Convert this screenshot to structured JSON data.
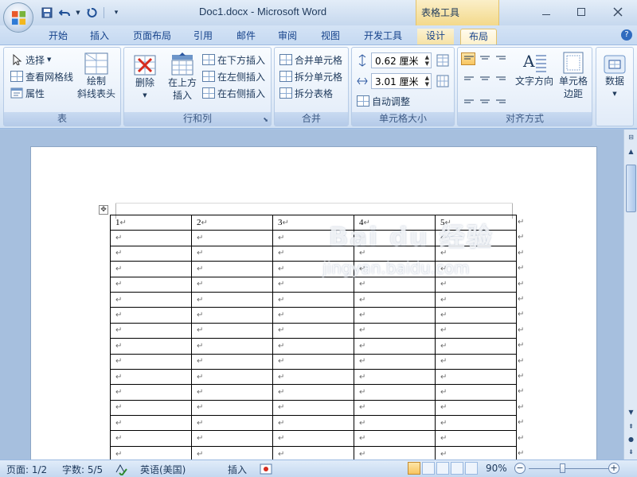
{
  "window": {
    "title": "Doc1.docx - Microsoft Word",
    "context_header": "表格工具"
  },
  "tabs": [
    {
      "label": "开始"
    },
    {
      "label": "插入"
    },
    {
      "label": "页面布局"
    },
    {
      "label": "引用"
    },
    {
      "label": "邮件"
    },
    {
      "label": "审阅"
    },
    {
      "label": "视图"
    },
    {
      "label": "开发工具"
    },
    {
      "label": "设计"
    },
    {
      "label": "布局"
    }
  ],
  "ribbon": {
    "table_group": {
      "label": "表",
      "select": "选择",
      "view_gridlines": "查看网格线",
      "properties": "属性",
      "draw_diagonal_line1": "绘制",
      "draw_diagonal_line2": "斜线表头"
    },
    "rows_cols_group": {
      "label": "行和列",
      "delete": "删除",
      "insert_above_line1": "在上方",
      "insert_above_line2": "插入",
      "insert_below": "在下方插入",
      "insert_left": "在左侧插入",
      "insert_right": "在右侧插入"
    },
    "merge_group": {
      "label": "合并",
      "merge_cells": "合并单元格",
      "split_cells": "拆分单元格",
      "split_table": "拆分表格"
    },
    "cell_size_group": {
      "label": "单元格大小",
      "height_value": "0.62 厘米",
      "width_value": "3.01 厘米",
      "autofit": "自动调整"
    },
    "alignment_group": {
      "label": "对齐方式",
      "text_direction": "文字方向",
      "cell_margins_line1": "单元格",
      "cell_margins_line2": "边距"
    },
    "data_group": {
      "label": "数据"
    }
  },
  "document": {
    "header_row": [
      "1",
      "2",
      "3",
      "4",
      "5"
    ],
    "paragraph_mark": "↵",
    "empty_row_count": 15
  },
  "statusbar": {
    "page": "页面: 1/2",
    "words": "字数: 5/5",
    "language": "英语(美国)",
    "mode": "插入",
    "zoom": "90%"
  },
  "watermark": {
    "logo": "Bai du 经验",
    "url": "jingyan.baidu.com"
  },
  "colors": {
    "context_tab": "#f6e2a5",
    "accent": "#15428b",
    "selected_button": "#f8c560"
  }
}
